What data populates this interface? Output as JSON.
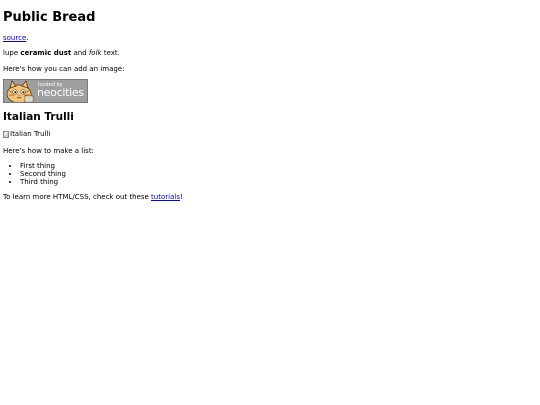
{
  "page": {
    "title": "Public Bread",
    "source_link": "source",
    "source_suffix": ".",
    "lupe": {
      "prefix": "lupe ",
      "bold": "ceramic dust",
      "middle": " and ",
      "italic": "folk",
      "suffix": " text."
    },
    "image_intro": "Here's how you can add an image:",
    "badge": {
      "hosted_text": "hosted by",
      "brand_text": "neocities",
      "color": "#9e9e9e"
    },
    "section_heading": "Italian Trulli",
    "broken_image_alt": "Italian Trulli",
    "list_intro": "Here's how to make a list:",
    "list_items": [
      "First thing",
      "Second thing",
      "Third thing"
    ],
    "tutorials": {
      "prefix": "To learn more HTML/CSS, check out these ",
      "link": "tutorials",
      "suffix": "!"
    },
    "link_color": "#0000ee"
  }
}
